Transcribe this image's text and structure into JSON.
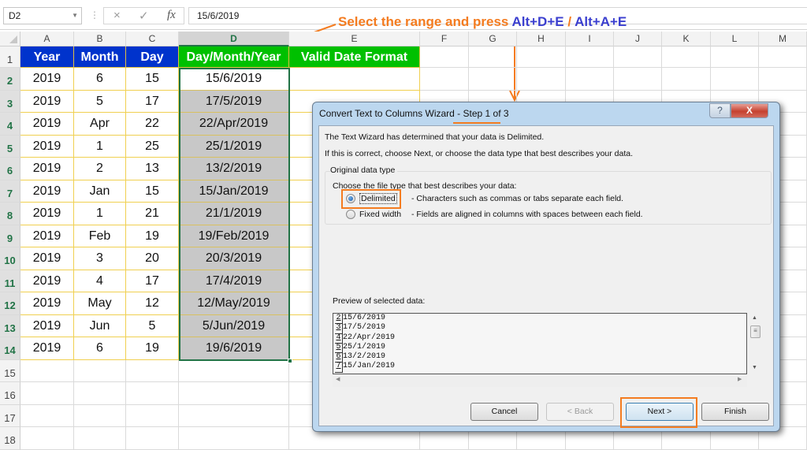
{
  "formula_bar": {
    "name_box": "D2",
    "formula": "15/6/2019",
    "cancel_icon": "×",
    "enter_icon": "✓",
    "fx_label": "fx"
  },
  "annotation": {
    "text_prefix": "Select the range and press ",
    "shortcut_1": "Alt+D+E",
    "separator": " / ",
    "shortcut_2": "Alt+A+E",
    "accent_color": "#f47c20",
    "shortcut_color": "#3b3fcf"
  },
  "columns": [
    "A",
    "B",
    "C",
    "D",
    "E",
    "F",
    "G",
    "H",
    "I",
    "J",
    "K",
    "L",
    "M"
  ],
  "selected_column": "D",
  "rows": [
    "1",
    "2",
    "3",
    "4",
    "5",
    "6",
    "7",
    "8",
    "9",
    "10",
    "11",
    "12",
    "13",
    "14",
    "15",
    "16",
    "17",
    "18"
  ],
  "table": {
    "headers": [
      "Year",
      "Month",
      "Day",
      "Day/Month/Year",
      "Valid Date Format"
    ],
    "header_colors": {
      "blue": "#0033cc",
      "green": "#00c000"
    },
    "data": [
      [
        "2019",
        "6",
        "15",
        "15/6/2019"
      ],
      [
        "2019",
        "5",
        "17",
        "17/5/2019"
      ],
      [
        "2019",
        "Apr",
        "22",
        "22/Apr/2019"
      ],
      [
        "2019",
        "1",
        "25",
        "25/1/2019"
      ],
      [
        "2019",
        "2",
        "13",
        "13/2/2019"
      ],
      [
        "2019",
        "Jan",
        "15",
        "15/Jan/2019"
      ],
      [
        "2019",
        "1",
        "21",
        "21/1/2019"
      ],
      [
        "2019",
        "Feb",
        "19",
        "19/Feb/2019"
      ],
      [
        "2019",
        "3",
        "20",
        "20/3/2019"
      ],
      [
        "2019",
        "4",
        "17",
        "17/4/2019"
      ],
      [
        "2019",
        "May",
        "12",
        "12/May/2019"
      ],
      [
        "2019",
        "Jun",
        "5",
        "5/Jun/2019"
      ],
      [
        "2019",
        "6",
        "19",
        "19/6/2019"
      ]
    ]
  },
  "dialog": {
    "title": "Convert Text to Columns Wizard - Step 1 of 3",
    "help_label": "?",
    "close_label": "X",
    "line1": "The Text Wizard has determined that your data is Delimited.",
    "line2": "If this is correct, choose Next, or choose the data type that best describes your data.",
    "group_label": "Original data type",
    "choose_label": "Choose the file type that best describes your data:",
    "options": [
      {
        "label": "Delimited",
        "description": "- Characters such as commas or tabs separate each field.",
        "selected": true
      },
      {
        "label": "Fixed width",
        "description": "- Fields are aligned in columns with spaces between each field.",
        "selected": false
      }
    ],
    "preview_label": "Preview of selected data:",
    "preview_rows": [
      {
        "num": "2",
        "text": "15/6/2019"
      },
      {
        "num": "3",
        "text": "17/5/2019"
      },
      {
        "num": "4",
        "text": "22/Apr/2019"
      },
      {
        "num": "5",
        "text": "25/1/2019"
      },
      {
        "num": "6",
        "text": "13/2/2019"
      },
      {
        "num": "7",
        "text": "15/Jan/2019"
      }
    ],
    "buttons": {
      "cancel": "Cancel",
      "back": "< Back",
      "next": "Next >",
      "finish": "Finish"
    }
  }
}
